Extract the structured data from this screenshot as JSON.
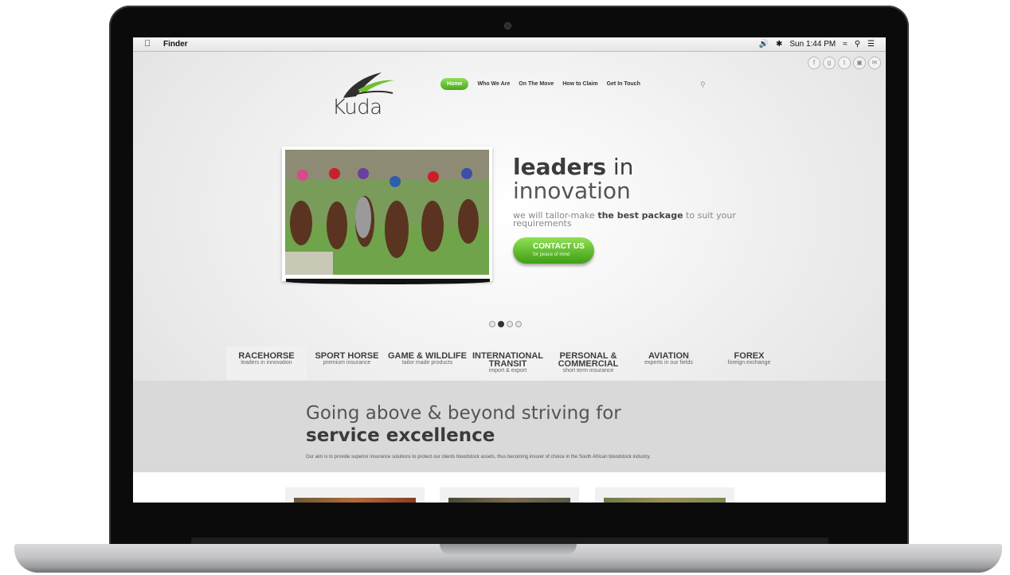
{
  "menubar": {
    "app_name": "Finder",
    "clock": "Sun 1:44 PM",
    "icons": [
      "apple-icon",
      "volume-icon",
      "bluetooth-icon",
      "wifi-icon",
      "search-icon",
      "list-icon"
    ]
  },
  "social_icons": [
    "facebook-icon",
    "google-plus-icon",
    "twitter-icon",
    "instagram-icon",
    "email-icon"
  ],
  "brand": {
    "name": "Kuda",
    "logo_colors": [
      "#333333",
      "#6cc22c"
    ]
  },
  "nav": {
    "items": [
      "Home",
      "Who We Are",
      "On The Move",
      "How to Claim",
      "Get In Touch"
    ],
    "active": "Home"
  },
  "hero": {
    "headline_bold": "leaders",
    "headline_rest": " in",
    "headline_line2": "innovation",
    "tagline_pre": "we will tailor-make ",
    "tagline_bold": "the best package",
    "tagline_post": " to suit your requirements",
    "cta_title": "CONTACT US",
    "cta_sub": "for peace of mind",
    "slider_total": 4,
    "slider_active": 2
  },
  "tabs": [
    {
      "title": "RACEHORSE",
      "sub": "leaders in innovation"
    },
    {
      "title": "SPORT HORSE",
      "sub": "premium insurance"
    },
    {
      "title": "GAME & WILDLIFE",
      "sub": "tailor made products"
    },
    {
      "title": "INTERNATIONAL TRANSIT",
      "sub": "import & export"
    },
    {
      "title": "PERSONAL & COMMERCIAL",
      "sub": "short term insurance"
    },
    {
      "title": "AVIATION",
      "sub": "experts in our fields"
    },
    {
      "title": "FOREX",
      "sub": "foreign exchange"
    }
  ],
  "intro": {
    "heading_pre": "Going above & beyond striving for ",
    "heading_bold": "service excellence",
    "text": "Our aim is to provide superior insurance solutions to protect our clients bloodstock assets, thus becoming insurer of choice in the South African bloodstock industry."
  },
  "colors": {
    "accent_green": "#5cb82a",
    "text_dark": "#3c3c3c"
  }
}
